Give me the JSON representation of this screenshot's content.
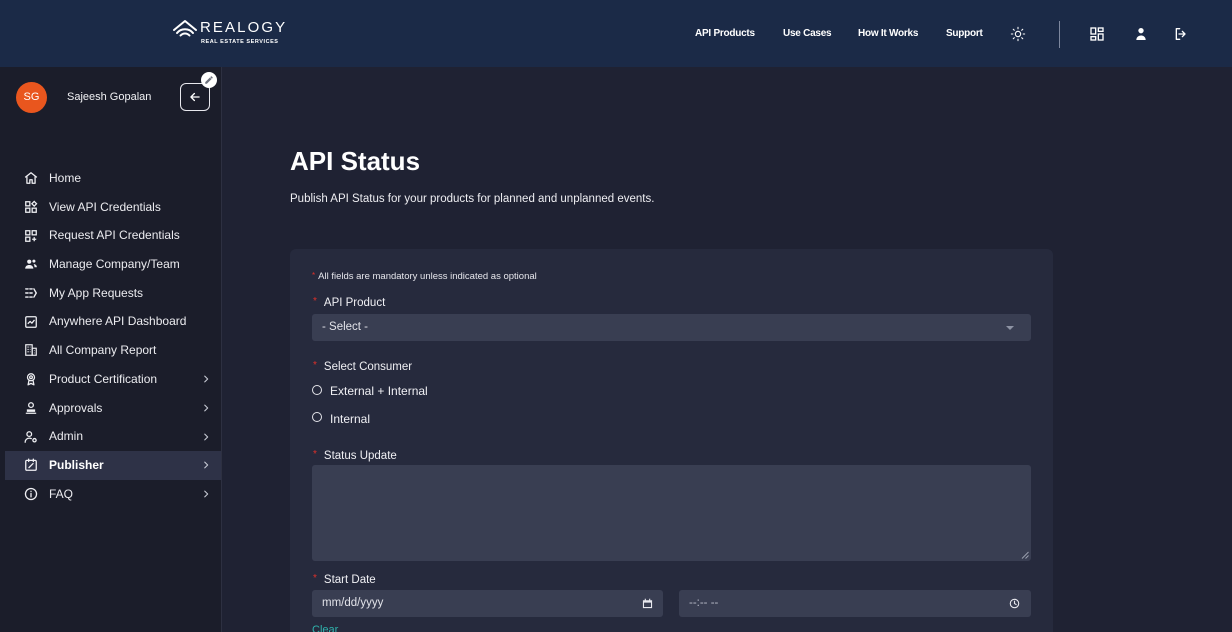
{
  "header": {
    "logo": {
      "wordmark": "REALOGY",
      "tagline": "REAL ESTATE SERVICES",
      "icon": "realogy-roof-icon"
    },
    "nav": [
      {
        "label": "API Products"
      },
      {
        "label": "Use Cases"
      },
      {
        "label": "How It Works"
      },
      {
        "label": "Support"
      }
    ],
    "actions": [
      {
        "icon": "sun-icon"
      },
      {
        "icon": "apps-grid-icon"
      },
      {
        "icon": "user-icon"
      },
      {
        "icon": "logout-icon"
      }
    ]
  },
  "sidebar": {
    "user": {
      "initials": "SG",
      "name": "Sajeesh Gopalan"
    },
    "collapse_icon": "arrow-left-icon",
    "edit_icon": "pencil-icon",
    "items": [
      {
        "label": "Home",
        "icon": "home-icon",
        "has_submenu": false,
        "active": false
      },
      {
        "label": "View API Credentials",
        "icon": "view-credentials-icon",
        "has_submenu": false,
        "active": false
      },
      {
        "label": "Request API Credentials",
        "icon": "request-credentials-icon",
        "has_submenu": false,
        "active": false
      },
      {
        "label": "Manage Company/Team",
        "icon": "team-icon",
        "has_submenu": false,
        "active": false
      },
      {
        "label": "My App Requests",
        "icon": "app-requests-icon",
        "has_submenu": false,
        "active": false
      },
      {
        "label": "Anywhere API Dashboard",
        "icon": "dashboard-icon",
        "has_submenu": false,
        "active": false
      },
      {
        "label": "All Company Report",
        "icon": "building-icon",
        "has_submenu": false,
        "active": false
      },
      {
        "label": "Product Certification",
        "icon": "certification-icon",
        "has_submenu": true,
        "active": false
      },
      {
        "label": "Approvals",
        "icon": "approvals-icon",
        "has_submenu": true,
        "active": false
      },
      {
        "label": "Admin",
        "icon": "admin-icon",
        "has_submenu": true,
        "active": false
      },
      {
        "label": "Publisher",
        "icon": "publisher-icon",
        "has_submenu": true,
        "active": true
      },
      {
        "label": "FAQ",
        "icon": "info-icon",
        "has_submenu": true,
        "active": false
      }
    ]
  },
  "main": {
    "title": "API Status",
    "subtitle": "Publish API Status for your products for planned and unplanned events.",
    "form": {
      "required_mark": "*",
      "mandatory_note": "All fields are mandatory unless indicated as optional",
      "api_product": {
        "label": "API Product",
        "selected": "- Select -"
      },
      "consumer": {
        "label": "Select Consumer",
        "options": [
          {
            "label": "External + Internal",
            "checked": false
          },
          {
            "label": "Internal",
            "checked": false
          }
        ]
      },
      "status_update": {
        "label": "Status Update",
        "value": ""
      },
      "start_date": {
        "label": "Start Date",
        "date_placeholder": "mm/dd/yyyy",
        "time_placeholder": "--:-- --",
        "date_icon": "calendar-icon",
        "time_icon": "clock-icon",
        "clear_label": "Clear"
      }
    }
  },
  "colors": {
    "header_bg": "#1b2a47",
    "sidebar_bg": "#1b1d2a",
    "page_bg": "#1f2233",
    "card_bg": "#262a3d",
    "input_bg": "#393e52",
    "active_item_bg": "#2e3247",
    "avatar": "#e9561e",
    "required": "#e0302a",
    "link": "#2fb3ad"
  }
}
